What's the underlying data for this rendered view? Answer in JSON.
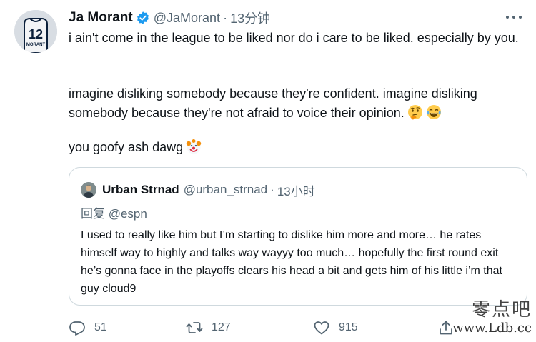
{
  "tweet": {
    "author_name": "Ja Morant",
    "author_handle": "@JaMorant",
    "separator": "·",
    "time": "13分钟",
    "jersey_number": "12",
    "jersey_name": "MORANT",
    "paragraph_1": "i ain't come in the league to be liked nor do i care to be liked. especially by you.",
    "paragraph_2": "imagine disliking somebody because they're confident. imagine disliking somebody because they're not afraid to voice their opinion.",
    "paragraph_2_emojis": [
      "thinking-face",
      "face-with-tears-of-joy"
    ],
    "paragraph_3": "you goofy ash dawg",
    "paragraph_3_emoji": "clown-face"
  },
  "quoted_tweet": {
    "author_name": "Urban Strnad",
    "author_handle": "@urban_strnad",
    "separator": "·",
    "time": "13小时",
    "reply_to": "回复 @espn",
    "text": "I used to really like him but I’m starting to dislike him more and more… he rates himself way to highly and talks way wayyy too much… hopefully the first round exit he’s gonna face in the playoffs clears his head a bit and gets him of his little i’m that guy cloud9"
  },
  "actions": {
    "reply_count": "51",
    "retweet_count": "127",
    "like_count": "915"
  },
  "watermark": {
    "chinese": "零点吧",
    "url": "www.Ldb.cc"
  },
  "colors": {
    "verified": "#1d9bf0",
    "secondary_text": "#536471",
    "border": "#cfd9de"
  }
}
